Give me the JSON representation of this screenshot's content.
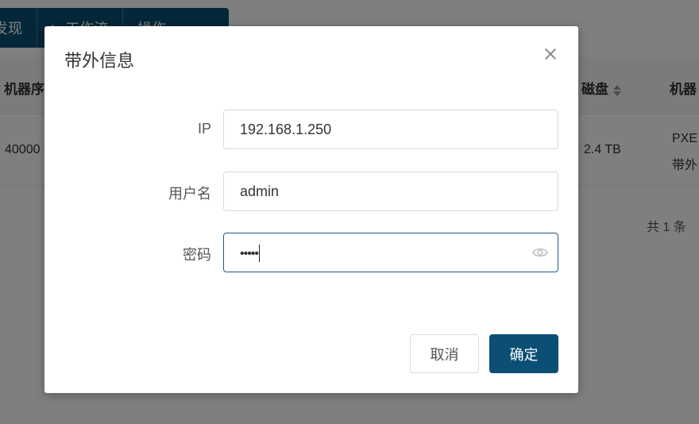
{
  "toolbar": {
    "items": [
      {
        "label": "发现"
      },
      {
        "label": "工作流"
      },
      {
        "label": "操作"
      }
    ]
  },
  "table": {
    "headers": {
      "serial": "机器序",
      "disk": "磁盘",
      "machine": "机器"
    },
    "row": {
      "serial": "40000",
      "disk": "2.4 TB",
      "machine_line1": "PXE",
      "machine_line2": "带外"
    }
  },
  "pager": {
    "total": "共 1 条"
  },
  "dialog": {
    "title": "带外信息",
    "fields": {
      "ip_label": "IP",
      "ip_value": "192.168.1.250",
      "username_label": "用户名",
      "username_value": "admin",
      "password_label": "密码",
      "password_masked": "•••••"
    },
    "buttons": {
      "cancel": "取消",
      "ok": "确定"
    }
  },
  "colors": {
    "primary": "#0b4f74",
    "mask": "rgba(0,0,0,0.5)"
  }
}
